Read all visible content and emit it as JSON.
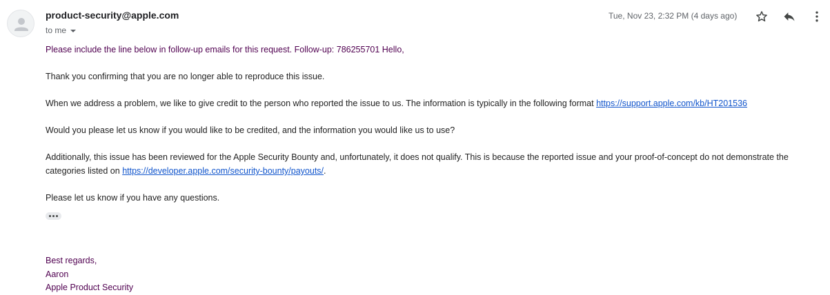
{
  "email": {
    "sender": "product-security@apple.com",
    "recipient_label": "to me",
    "date": "Tue, Nov 23, 2:32 PM (4 days ago)",
    "icons": {
      "avatar": "person-avatar-icon",
      "star": "star-icon",
      "reply": "reply-icon",
      "more": "more-vert-icon"
    },
    "body": {
      "followup_line": "Please include the line below in follow-up emails for this request. Follow-up: 786255701 Hello,",
      "thanks": "Thank you confirming that you are no longer able to reproduce this issue.",
      "credit_text": "When we address a problem, we like to give credit to the person who reported the issue to us. The information is typically in the following format ",
      "credit_link": "https://support.apple.com/kb/HT201536",
      "credit_question": "Would you please let us know if you would like to be credited, and the information you would like us to use?",
      "bounty_line1": "Additionally, this issue has been reviewed for the Apple Security Bounty and, unfortunately, it does not qualify. This is because the reported issue and your proof-of-concept do not demonstrate the",
      "bounty_line2_prefix": "categories listed on ",
      "bounty_link": "https://developer.apple.com/security-bounty/payouts/",
      "bounty_line2_suffix": ".",
      "questions": "Please let us know if you have any questions."
    },
    "signature": {
      "closing": "Best regards,",
      "name": "Aaron",
      "team": "Apple Product Security"
    },
    "colors": {
      "quoted_purple": "#500050",
      "link_blue": "#1155cc",
      "text": "#222222",
      "meta_gray": "#5f6368"
    }
  }
}
